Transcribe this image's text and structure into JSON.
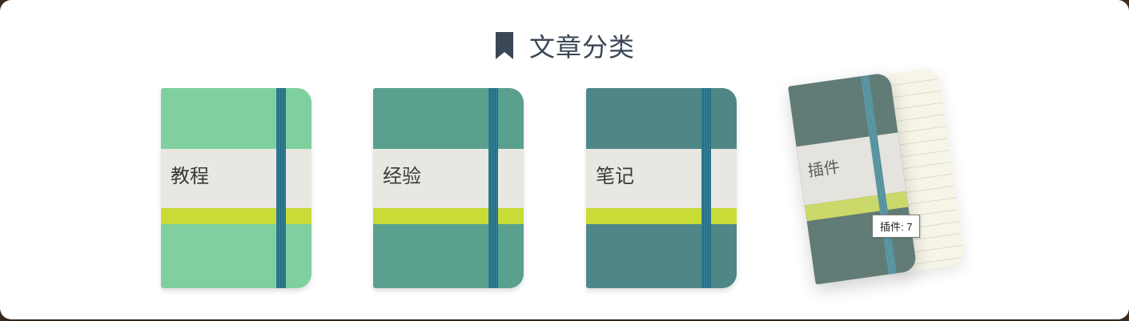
{
  "header": {
    "icon": "bookmark-icon",
    "title": "文章分类"
  },
  "categories": [
    {
      "label": "教程",
      "color": "#7fd09e"
    },
    {
      "label": "经验",
      "color": "#5aa08e"
    },
    {
      "label": "笔记",
      "color": "#4f8789"
    },
    {
      "label": "插件",
      "color": "#617c76"
    }
  ],
  "tooltip": {
    "text": "插件: 7"
  },
  "colors": {
    "label_strip": "#e9e7e1",
    "accent_stripe": "#c9db37",
    "elastic_band": "#2e7d93",
    "title_text": "#3b4656"
  }
}
